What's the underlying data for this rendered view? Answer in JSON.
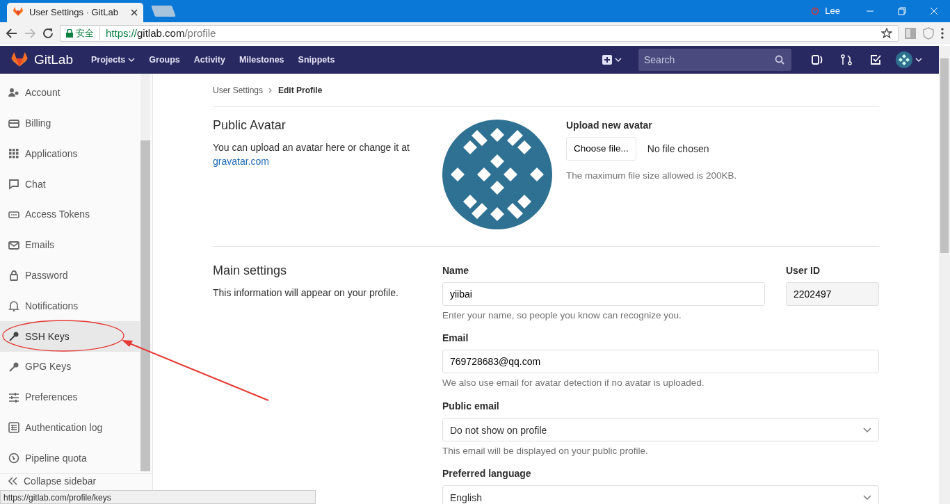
{
  "browser": {
    "tab_title": "User Settings · GitLab",
    "profile_name": "Lee",
    "security_label": "安全",
    "url_scheme": "https://",
    "url_host": "gitlab.com",
    "url_path": "/profile"
  },
  "navbar": {
    "brand": "GitLab",
    "links": [
      {
        "label": "Projects",
        "dropdown": true
      },
      {
        "label": "Groups",
        "dropdown": false
      },
      {
        "label": "Activity",
        "dropdown": false
      },
      {
        "label": "Milestones",
        "dropdown": false
      },
      {
        "label": "Snippets",
        "dropdown": false
      }
    ],
    "search": {
      "placeholder": "Search"
    }
  },
  "sidebar": {
    "items": [
      {
        "label": "Account",
        "highlighted": false
      },
      {
        "label": "Billing",
        "highlighted": false
      },
      {
        "label": "Applications",
        "highlighted": false
      },
      {
        "label": "Chat",
        "highlighted": false
      },
      {
        "label": "Access Tokens",
        "highlighted": false
      },
      {
        "label": "Emails",
        "highlighted": false
      },
      {
        "label": "Password",
        "highlighted": false
      },
      {
        "label": "Notifications",
        "highlighted": false
      },
      {
        "label": "SSH Keys",
        "highlighted": true
      },
      {
        "label": "GPG Keys",
        "highlighted": false
      },
      {
        "label": "Preferences",
        "highlighted": false
      },
      {
        "label": "Authentication log",
        "highlighted": false
      },
      {
        "label": "Pipeline quota",
        "highlighted": false
      }
    ],
    "collapse": "Collapse sidebar"
  },
  "breadcrumb": [
    "User Settings",
    "Edit Profile"
  ],
  "avatar_section": {
    "title": "Public Avatar",
    "description": "You can upload an avatar here or change it at",
    "link": "gravatar.com",
    "upload_title": "Upload new avatar",
    "choose_button": "Choose file...",
    "file_status": "No file chosen",
    "hint": "The maximum file size allowed is 200KB."
  },
  "main_settings": {
    "title": "Main settings",
    "description": "This information will appear on your profile.",
    "rows": [
      {
        "fields": [
          {
            "kind": "input",
            "label": "Name",
            "value": "yiibai",
            "help": "Enter your name, so people you know can recognize you."
          },
          {
            "kind": "readonly",
            "label": "User ID",
            "value": "2202497"
          }
        ]
      },
      {
        "fields": [
          {
            "kind": "input",
            "label": "Email",
            "value": "769728683@qq.com",
            "help": "We also use email for avatar detection if no avatar is uploaded."
          }
        ]
      },
      {
        "fields": [
          {
            "kind": "select",
            "label": "Public email",
            "value": "Do not show on profile",
            "help": "This email will be displayed on your public profile."
          }
        ]
      },
      {
        "fields": [
          {
            "kind": "select",
            "label": "Preferred language",
            "value": "English"
          }
        ]
      }
    ]
  },
  "status_bar": {
    "url": "https://gitlab.com/profile/keys"
  }
}
